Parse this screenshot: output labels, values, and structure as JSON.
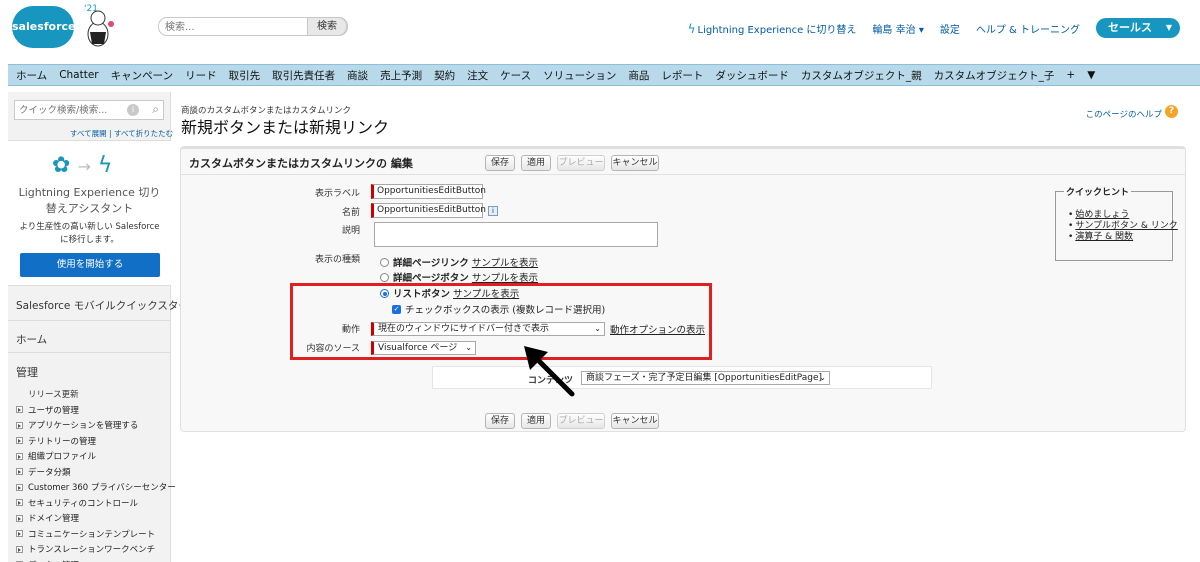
{
  "header": {
    "logo_text": "salesforce",
    "mascot_year": "'21",
    "search_placeholder": "検索...",
    "search_button": "検索",
    "lightning_switch": "Lightning Experience に切り替え",
    "user_name": "輪島 幸治",
    "setup": "設定",
    "help_training": "ヘルプ & トレーニング",
    "app_name": "セールス"
  },
  "tabs": [
    "ホーム",
    "Chatter",
    "キャンペーン",
    "リード",
    "取引先",
    "取引先責任者",
    "商談",
    "売上予測",
    "契約",
    "注文",
    "ケース",
    "ソリューション",
    "商品",
    "レポート",
    "ダッシュボード",
    "カスタムオブジェクト_親",
    "カスタムオブジェクト_子",
    "+",
    "▼"
  ],
  "sidebar": {
    "quick_search_placeholder": "クイック検索/検索...",
    "expand_links": "すべて展開 | すべて折りたたむ",
    "lex_title": "Lightning Experience 切り替えアシスタント",
    "lex_desc": "より生産性の高い新しい Salesforce に移行します。",
    "lex_button": "使用を開始する",
    "mobile": "Salesforce モバイルクイックスタート",
    "home": "ホーム",
    "admin": "管理",
    "release": "リリース更新",
    "items": [
      "ユーザの管理",
      "アプリケーションを管理する",
      "テリトリーの管理",
      "組織プロファイル",
      "データ分類",
      "Customer 360 プライバシーセンター",
      "セキュリティのコントロール",
      "ドメイン管理",
      "コミュニケーションテンプレート",
      "トランスレーションワークベンチ",
      "データの管理"
    ]
  },
  "page": {
    "breadcrumb": "商談のカスタムボタンまたはカスタムリンク",
    "title": "新規ボタンまたは新規リンク",
    "help_link": "このページのヘルプ",
    "help_icon": "?"
  },
  "panel": {
    "title": "カスタムボタンまたはカスタムリンクの 編集",
    "buttons": {
      "save": "保存",
      "apply": "適用",
      "preview": "プレビュー",
      "cancel": "キャンセル"
    }
  },
  "form": {
    "display_label_label": "表示ラベル",
    "display_label_value": "OpportunitiesEditButton",
    "name_label": "名前",
    "name_value": "OpportunitiesEditButton",
    "name_info": "i",
    "description_label": "説明",
    "display_type_label": "表示の種類",
    "detail_link": "詳細ページリンク",
    "detail_button": "詳細ページボタン",
    "list_button": "リストボタン",
    "show_sample": "サンプルを表示",
    "checkbox_label": "チェックボックスの表示 (複数レコード選択用)",
    "action_label": "動作",
    "action_value": "現在のウィンドウにサイドバー付きで表示",
    "action_options_link": "動作オプションの表示",
    "source_label": "内容のソース",
    "source_value": "Visualforce ページ",
    "content_label": "コンテンツ",
    "content_value": "商談フェーズ・完了予定日編集 [OpportunitiesEditPage]"
  },
  "quick_hint": {
    "title": "クイックヒント",
    "links": [
      "始めましょう",
      "サンプルボタン & リンク",
      "演算子 & 関数"
    ]
  },
  "colors": {
    "brand": "#1797c0",
    "tabbar": "#b7d9e9",
    "highlight": "#e01f1f",
    "required": "#cc0000"
  }
}
